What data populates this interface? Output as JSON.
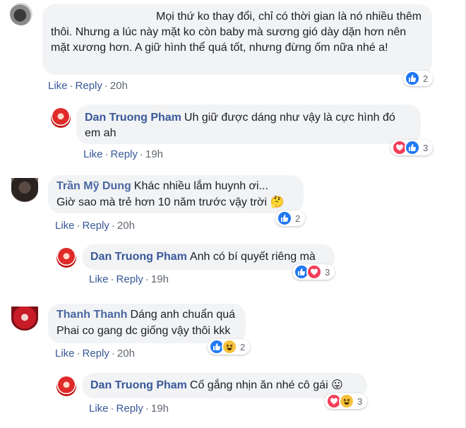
{
  "comments": [
    {
      "author": "",
      "text": "Mọi thứ ko thay đổi, chỉ có thời gian là nó nhiều thêm thôi. Nhưng a lúc này mặt ko còn baby mà sương gió dày dặn hơn nên mặt xương hơn. A giữ hình thể quá tốt, nhưng đừng ốm nữa nhé a!",
      "actions": {
        "like": "Like",
        "reply": "Reply",
        "time": "20h"
      },
      "reaction_count": "2"
    },
    {
      "author": "Dan Truong Pham",
      "text": "Uh giữ được dáng như vậy là cực hình đó em ah",
      "actions": {
        "like": "Like",
        "reply": "Reply",
        "time": "19h"
      },
      "reaction_count": "3"
    },
    {
      "author": "Trần Mỹ Dung",
      "text_line1": "Khác nhiều lắm huynh ơi...",
      "text_line2": "Giờ sao mà trẻ hơn 10 năm trước vậy trời",
      "emoji": "🤔",
      "actions": {
        "like": "Like",
        "reply": "Reply",
        "time": "20h"
      },
      "reaction_count": "2"
    },
    {
      "author": "Dan Truong Pham",
      "text": "Anh có bí quyết riêng mà",
      "actions": {
        "like": "Like",
        "reply": "Reply",
        "time": "19h"
      },
      "reaction_count": "3"
    },
    {
      "author": "Thanh Thanh",
      "text_line1": "Dáng anh chuẩn quá",
      "text_line2": "Phai co gang dc giống vậy thôi kkk",
      "actions": {
        "like": "Like",
        "reply": "Reply",
        "time": "20h"
      },
      "reaction_count": "2"
    },
    {
      "author": "Dan Truong Pham",
      "text": "Cố gắng nhịn ăn nhé cô gái",
      "emoji": "😛",
      "actions": {
        "like": "Like",
        "reply": "Reply",
        "time": "19h"
      },
      "reaction_count": "3"
    }
  ],
  "colors": {
    "link": "#385898",
    "bubble": "#f2f3f5",
    "like": "#2078f4",
    "love": "#f33e58",
    "haha": "#f7c13a"
  }
}
